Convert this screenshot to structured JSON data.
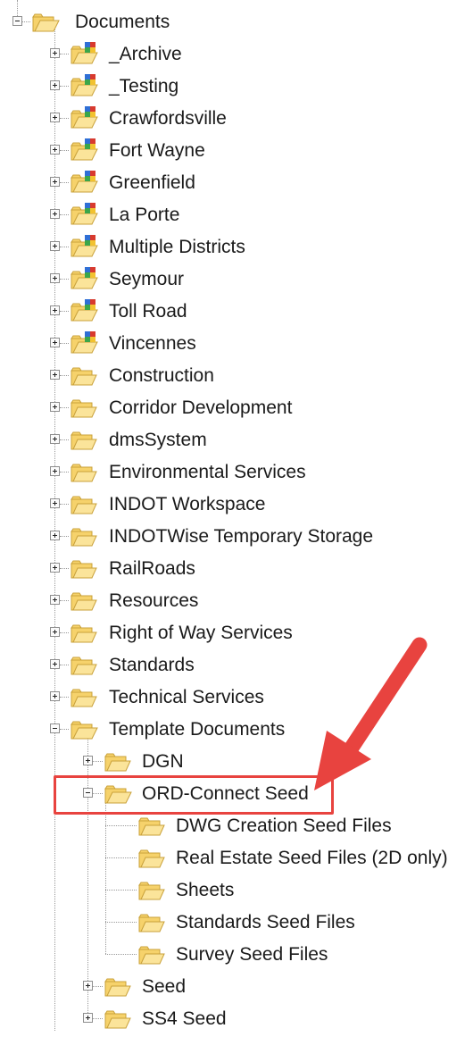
{
  "tree": [
    {
      "label": "Documents",
      "depth": 0,
      "icon": "folder-open-icon",
      "toggle": "minus"
    },
    {
      "label": "_Archive",
      "depth": 1,
      "icon": "colored-folder-icon",
      "toggle": "plus"
    },
    {
      "label": "_Testing",
      "depth": 1,
      "icon": "colored-folder-icon",
      "toggle": "plus"
    },
    {
      "label": "Crawfordsville",
      "depth": 1,
      "icon": "colored-folder-icon",
      "toggle": "plus"
    },
    {
      "label": "Fort Wayne",
      "depth": 1,
      "icon": "colored-folder-icon",
      "toggle": "plus"
    },
    {
      "label": "Greenfield",
      "depth": 1,
      "icon": "colored-folder-icon",
      "toggle": "plus"
    },
    {
      "label": "La Porte",
      "depth": 1,
      "icon": "colored-folder-icon",
      "toggle": "plus"
    },
    {
      "label": "Multiple Districts",
      "depth": 1,
      "icon": "colored-folder-icon",
      "toggle": "plus"
    },
    {
      "label": "Seymour",
      "depth": 1,
      "icon": "colored-folder-icon",
      "toggle": "plus"
    },
    {
      "label": "Toll Road",
      "depth": 1,
      "icon": "colored-folder-icon",
      "toggle": "plus"
    },
    {
      "label": "Vincennes",
      "depth": 1,
      "icon": "colored-folder-icon",
      "toggle": "plus"
    },
    {
      "label": "Construction",
      "depth": 1,
      "icon": "folder-icon",
      "toggle": "plus"
    },
    {
      "label": "Corridor Development",
      "depth": 1,
      "icon": "folder-icon",
      "toggle": "plus"
    },
    {
      "label": "dmsSystem",
      "depth": 1,
      "icon": "folder-icon",
      "toggle": "plus"
    },
    {
      "label": "Environmental Services",
      "depth": 1,
      "icon": "folder-icon",
      "toggle": "plus"
    },
    {
      "label": "INDOT Workspace",
      "depth": 1,
      "icon": "folder-icon",
      "toggle": "plus"
    },
    {
      "label": "INDOTWise Temporary Storage",
      "depth": 1,
      "icon": "folder-icon",
      "toggle": "plus"
    },
    {
      "label": "RailRoads",
      "depth": 1,
      "icon": "folder-icon",
      "toggle": "plus"
    },
    {
      "label": "Resources",
      "depth": 1,
      "icon": "folder-icon",
      "toggle": "plus"
    },
    {
      "label": "Right of Way Services",
      "depth": 1,
      "icon": "folder-icon",
      "toggle": "plus"
    },
    {
      "label": "Standards",
      "depth": 1,
      "icon": "folder-icon",
      "toggle": "plus"
    },
    {
      "label": "Technical Services",
      "depth": 1,
      "icon": "folder-icon",
      "toggle": "plus"
    },
    {
      "label": "Template Documents",
      "depth": 1,
      "icon": "folder-open-icon",
      "toggle": "minus"
    },
    {
      "label": "DGN",
      "depth": 2,
      "icon": "folder-icon",
      "toggle": "plus"
    },
    {
      "label": "ORD-Connect Seed",
      "depth": 2,
      "icon": "folder-open-icon",
      "toggle": "minus",
      "highlighted": true
    },
    {
      "label": "DWG Creation Seed Files",
      "depth": 3,
      "icon": "folder-icon",
      "toggle": "none"
    },
    {
      "label": "Real Estate Seed Files (2D only)",
      "depth": 3,
      "icon": "folder-icon",
      "toggle": "none"
    },
    {
      "label": "Sheets",
      "depth": 3,
      "icon": "folder-icon",
      "toggle": "none"
    },
    {
      "label": "Standards Seed Files",
      "depth": 3,
      "icon": "folder-icon",
      "toggle": "none"
    },
    {
      "label": "Survey Seed Files",
      "depth": 3,
      "icon": "folder-icon",
      "toggle": "none"
    },
    {
      "label": "Seed",
      "depth": 2,
      "icon": "folder-icon",
      "toggle": "plus"
    },
    {
      "label": "SS4 Seed",
      "depth": 2,
      "icon": "folder-icon",
      "toggle": "plus"
    }
  ],
  "colors": {
    "folder_fill": "#f6d26b",
    "folder_edge": "#c9a13a",
    "callout": "#e8433f",
    "badge_blue": "#2f6fd6",
    "badge_red": "#d83a2e",
    "badge_green": "#3aa64a",
    "badge_yellow": "#f2c230"
  }
}
